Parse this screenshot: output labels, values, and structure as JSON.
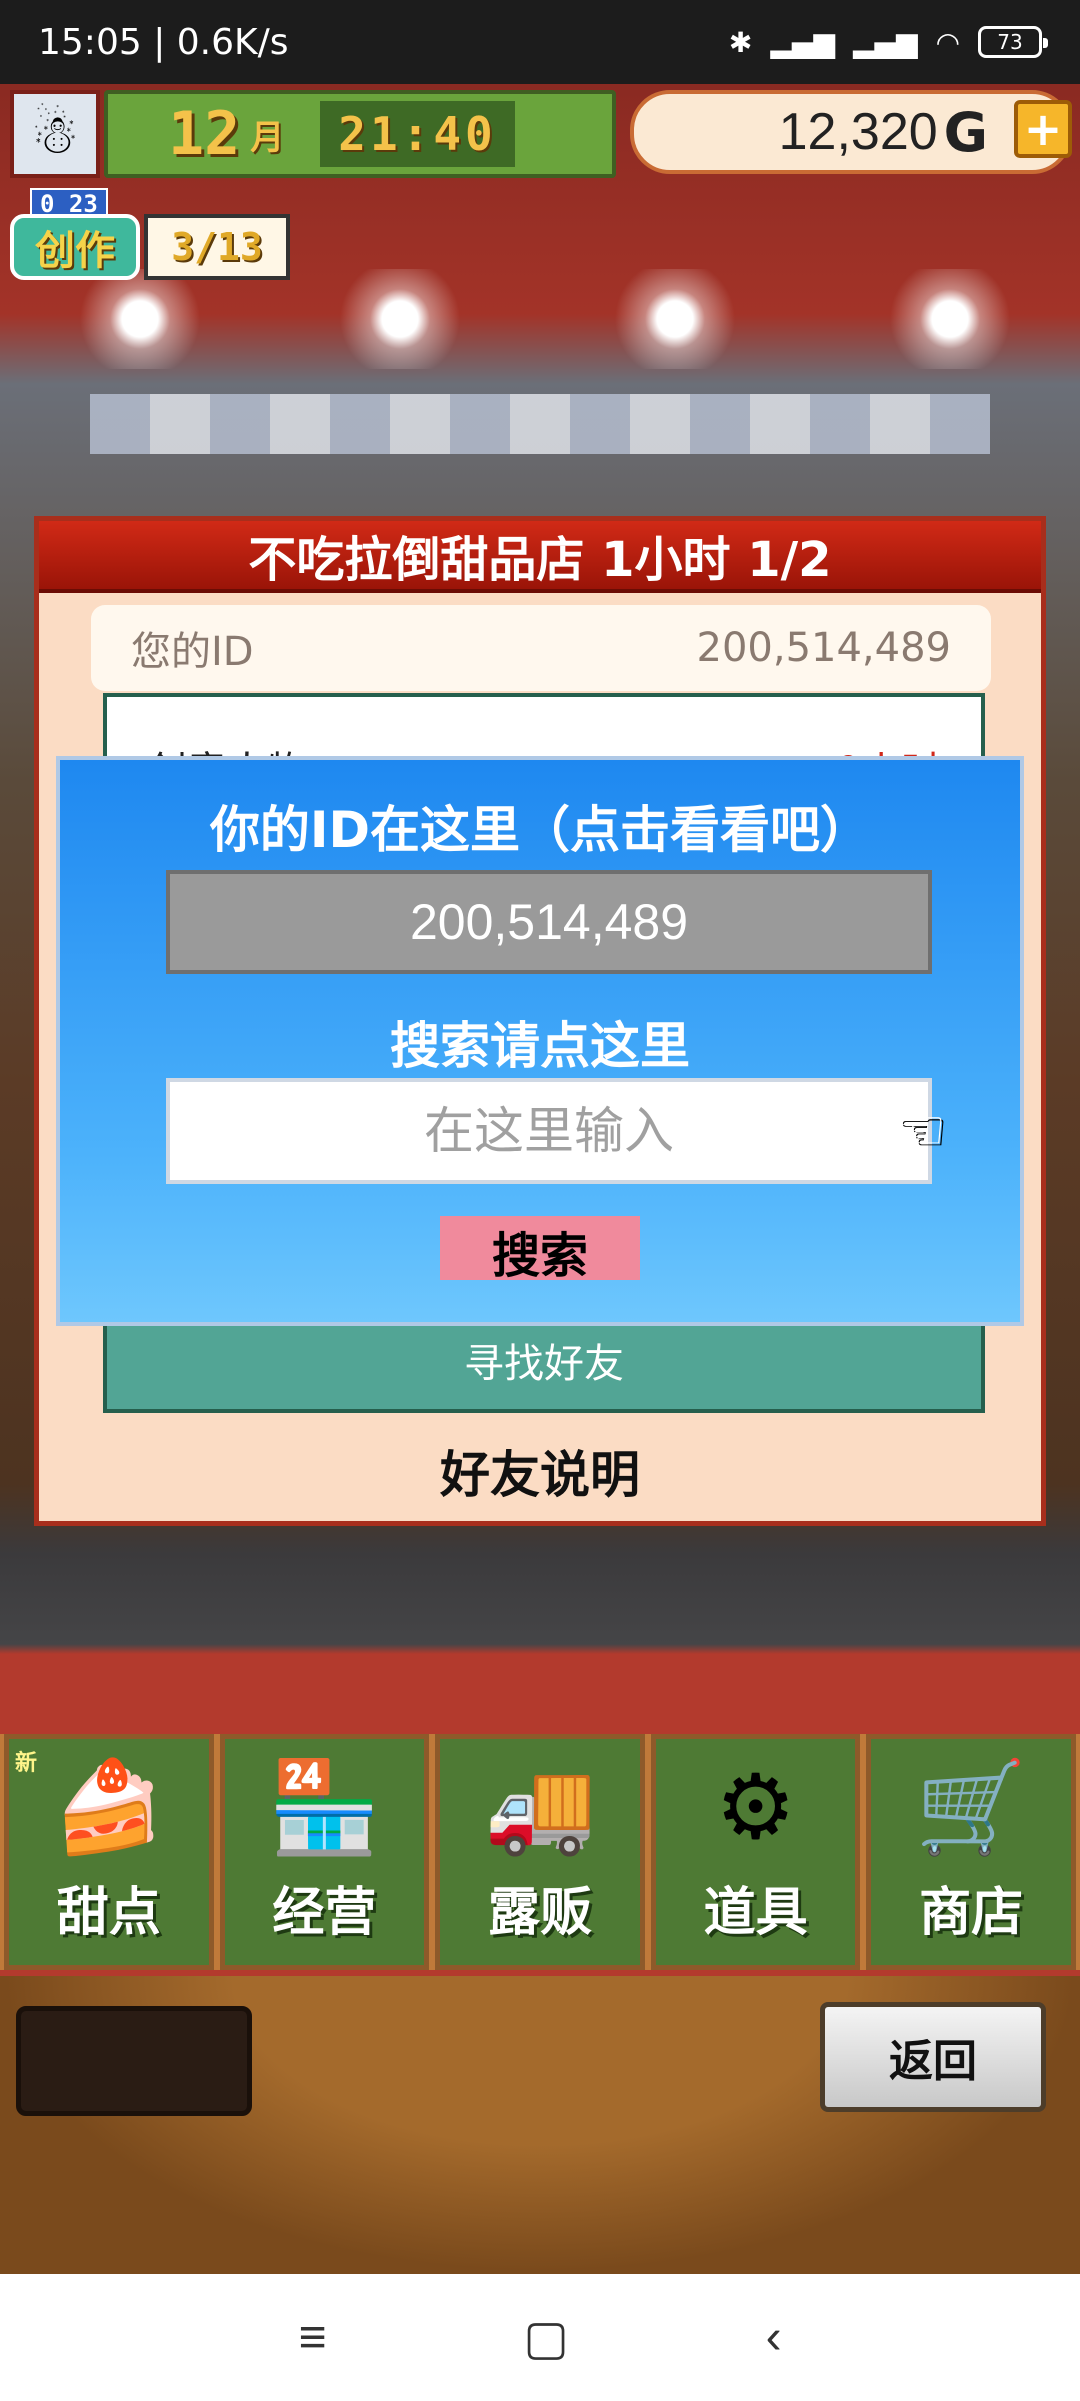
{
  "status": {
    "time": "15:05",
    "network_speed": "0.6K/s",
    "battery": "73"
  },
  "hud": {
    "month": "12",
    "month_unit": "月",
    "clock": "21:40",
    "money": "12,320",
    "money_unit": "G",
    "create": {
      "top_number": "0 23",
      "label": "创作",
      "count": "3/13"
    }
  },
  "panel": {
    "title": "不吃拉倒甜品店  1小时 1/2",
    "id_label": "您的ID",
    "id_value": "200,514,489",
    "partial_row_left": "创意人物",
    "partial_row_right": "0小时",
    "find_friend": "寻找好友",
    "footer": "好友说明"
  },
  "dialog": {
    "title": "你的ID在这里（点击看看吧）",
    "id_value": "200,514,489",
    "subtitle": "搜索请点这里",
    "input_placeholder": "在这里输入",
    "search_button": "搜索"
  },
  "menu": {
    "items": [
      {
        "label": "甜点",
        "icon": "cake-icon",
        "badge": "新"
      },
      {
        "label": "经营",
        "icon": "shop-icon"
      },
      {
        "label": "露贩",
        "icon": "food-truck-icon"
      },
      {
        "label": "道具",
        "icon": "tools-bag-icon"
      },
      {
        "label": "商店",
        "icon": "shopping-cart-icon"
      }
    ]
  },
  "back_button": "返回",
  "colors": {
    "dialog_blue": "#1e88f0",
    "panel_red": "#c8210f",
    "search_button_pink": "#f08a9c",
    "menu_green": "#4e7a34"
  }
}
